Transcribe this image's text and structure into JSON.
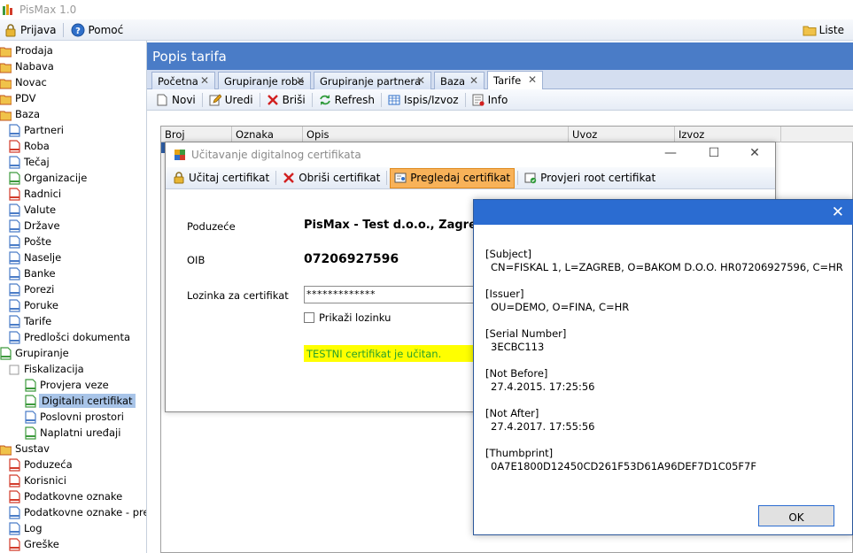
{
  "app": {
    "title": "PisMax 1.0"
  },
  "menu": {
    "login": "Prijava",
    "help": "Pomoć",
    "lists": "Liste"
  },
  "sidebar": {
    "items": [
      {
        "label": "Prodaja"
      },
      {
        "label": "Nabava"
      },
      {
        "label": "Novac"
      },
      {
        "label": "PDV"
      },
      {
        "label": "Baza"
      },
      {
        "label": "Partneri"
      },
      {
        "label": "Roba"
      },
      {
        "label": "Tečaj"
      },
      {
        "label": "Organizacije"
      },
      {
        "label": "Radnici"
      },
      {
        "label": "Valute"
      },
      {
        "label": "Države"
      },
      {
        "label": "Pošte"
      },
      {
        "label": "Naselje"
      },
      {
        "label": "Banke"
      },
      {
        "label": "Porezi"
      },
      {
        "label": "Poruke"
      },
      {
        "label": "Tarife"
      },
      {
        "label": "Predlošci dokumenta"
      },
      {
        "label": "Grupiranje"
      },
      {
        "label": "Fiskalizacija"
      },
      {
        "label": "Provjera veze"
      },
      {
        "label": "Digitalni certifikat"
      },
      {
        "label": "Poslovni prostori"
      },
      {
        "label": "Naplatni uređaji"
      },
      {
        "label": "Sustav"
      },
      {
        "label": "Poduzeća"
      },
      {
        "label": "Korisnici"
      },
      {
        "label": "Podatkovne oznake"
      },
      {
        "label": "Podatkovne oznake - pre…"
      },
      {
        "label": "Log"
      },
      {
        "label": "Greške"
      }
    ]
  },
  "content": {
    "title": "Popis tarifa"
  },
  "tabs": [
    {
      "label": "Početna"
    },
    {
      "label": "Grupiranje robe"
    },
    {
      "label": "Grupiranje partnera"
    },
    {
      "label": "Baza"
    },
    {
      "label": "Tarife"
    }
  ],
  "toolbar": {
    "new": "Novi",
    "edit": "Uredi",
    "delete": "Briši",
    "refresh": "Refresh",
    "print": "Ispis/Izvoz",
    "info": "Info"
  },
  "grid": {
    "columns": [
      "Broj",
      "Oznaka",
      "Opis",
      "Uvoz",
      "Izvoz"
    ]
  },
  "cert_dialog": {
    "title": "Učitavanje digitalnog certifikata",
    "toolbar": {
      "load": "Učitaj certifikat",
      "delete": "Obriši certifikat",
      "view": "Pregledaj certifikat",
      "check_root": "Provjeri root certifikat"
    },
    "company_label": "Poduzeće",
    "company_value": "PisMax - Test d.o.o., Zagreb",
    "oib_label": "OIB",
    "oib_value": "07206927596",
    "password_label": "Lozinka za certifikat",
    "password_value": "*************",
    "show_password": "Prikaži lozinku",
    "status": "TESTNI certifikat je učitan."
  },
  "info_dialog": {
    "sections": [
      {
        "header": "[Subject]",
        "value": "CN=FISKAL 1, L=ZAGREB, O=BAKOM  D.O.O. HR07206927596, C=HR"
      },
      {
        "header": "[Issuer]",
        "value": "OU=DEMO, O=FINA, C=HR"
      },
      {
        "header": "[Serial Number]",
        "value": "3ECBC113"
      },
      {
        "header": "[Not Before]",
        "value": "27.4.2015. 17:25:56"
      },
      {
        "header": "[Not After]",
        "value": "27.4.2017. 17:55:56"
      },
      {
        "header": "[Thumbprint]",
        "value": "0A7E1800D12450CD261F53D61A96DEF7D1C05F7F"
      }
    ],
    "ok": "OK"
  }
}
